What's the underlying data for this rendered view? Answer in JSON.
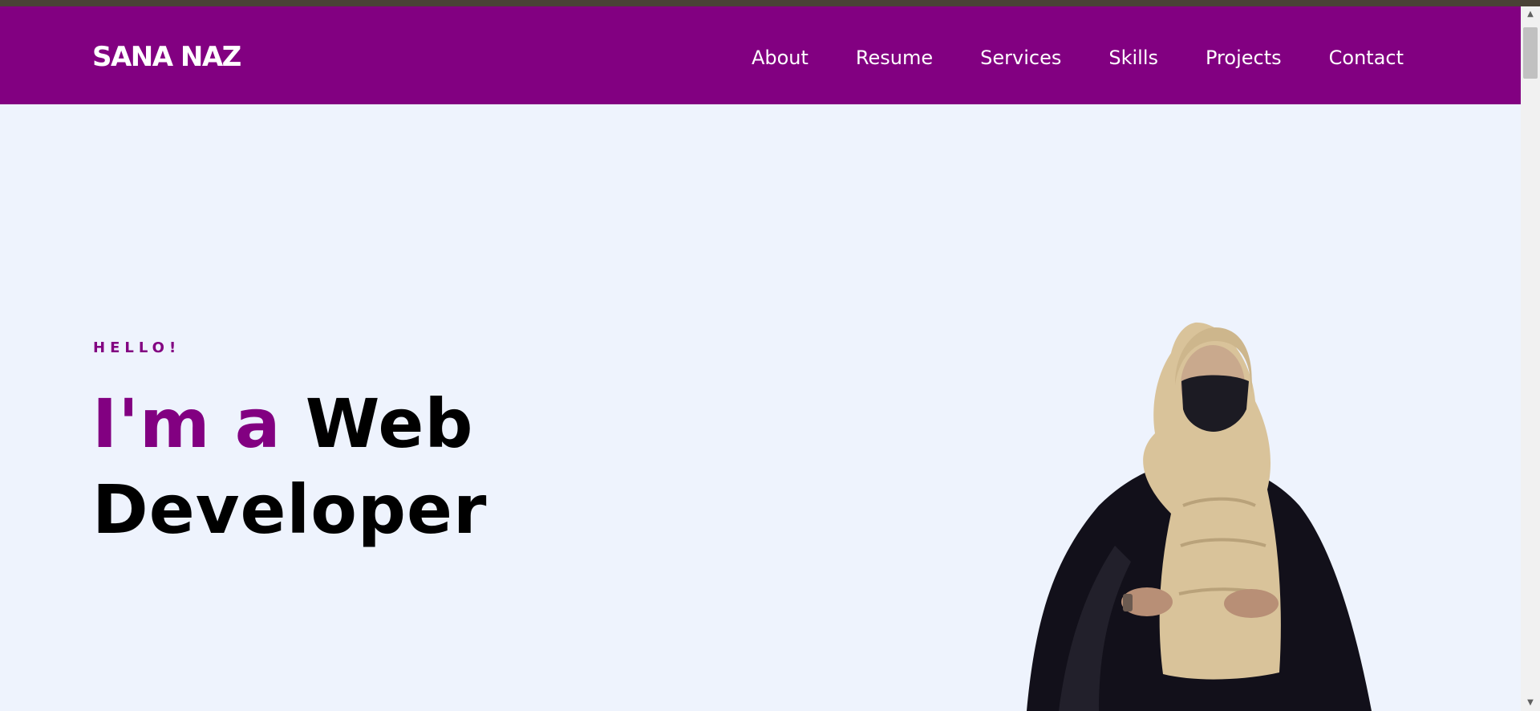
{
  "header": {
    "brand": "SANA NAZ",
    "nav": [
      {
        "label": "About"
      },
      {
        "label": "Resume"
      },
      {
        "label": "Services"
      },
      {
        "label": "Skills"
      },
      {
        "label": "Projects"
      },
      {
        "label": "Contact"
      }
    ]
  },
  "hero": {
    "greeting": "HELLO!",
    "headline_accent": "I'm a",
    "headline_rest": "Web",
    "headline_line2": "Developer"
  },
  "colors": {
    "accent": "#820081",
    "page_background": "#eef3fd",
    "heading_text": "#000000",
    "nav_text": "#ffffff"
  },
  "scrollbar": {
    "up_icon": "arrow-up-icon",
    "down_icon": "arrow-down-icon"
  }
}
